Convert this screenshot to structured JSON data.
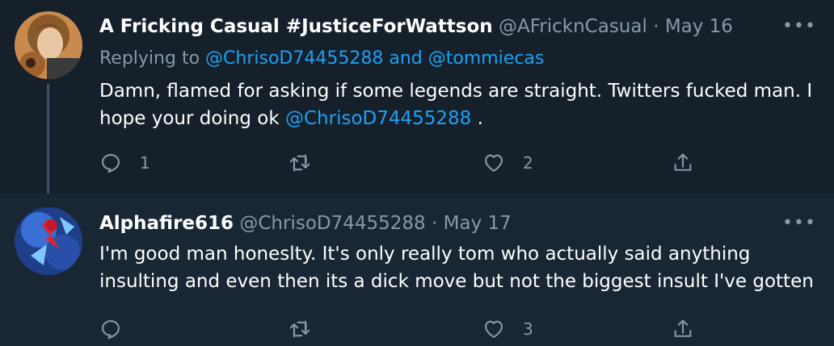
{
  "tweets": [
    {
      "name": "A Fricking Casual #JusticeForWattson",
      "handle": "@AFricknCasual",
      "separator": "·",
      "date": "May 16",
      "replying_prefix": "Replying to",
      "replying_user1": "@ChrisoD74455288",
      "replying_and": "and",
      "replying_user2": "@tommiecas",
      "text_part1": "Damn, flamed for asking if some legends are straight. Twitters fucked man. I hope your doing ok",
      "text_mention": "@ChrisoD74455288",
      "text_part2": ".",
      "reply_count": "1",
      "retweet_count": "",
      "like_count": "2",
      "more": "•••"
    },
    {
      "name": "Alphafire616",
      "handle": "@ChrisoD74455288",
      "separator": "·",
      "date": "May 17",
      "text": "I'm good man honeslty. It's only really tom who actually said anything insulting and even then its a dick move but not the biggest insult I've gotten",
      "reply_count": "",
      "retweet_count": "",
      "like_count": "3",
      "more": "•••"
    }
  ],
  "icons": {
    "reply": "reply-icon",
    "retweet": "retweet-icon",
    "like": "like-icon",
    "share": "share-icon",
    "more": "more-icon"
  },
  "colors": {
    "background": "#15202b",
    "secondary_background": "#192734",
    "text": "#ffffff",
    "muted": "#8899a6",
    "accent": "#1da1f2",
    "thread_line": "#3d5466"
  }
}
